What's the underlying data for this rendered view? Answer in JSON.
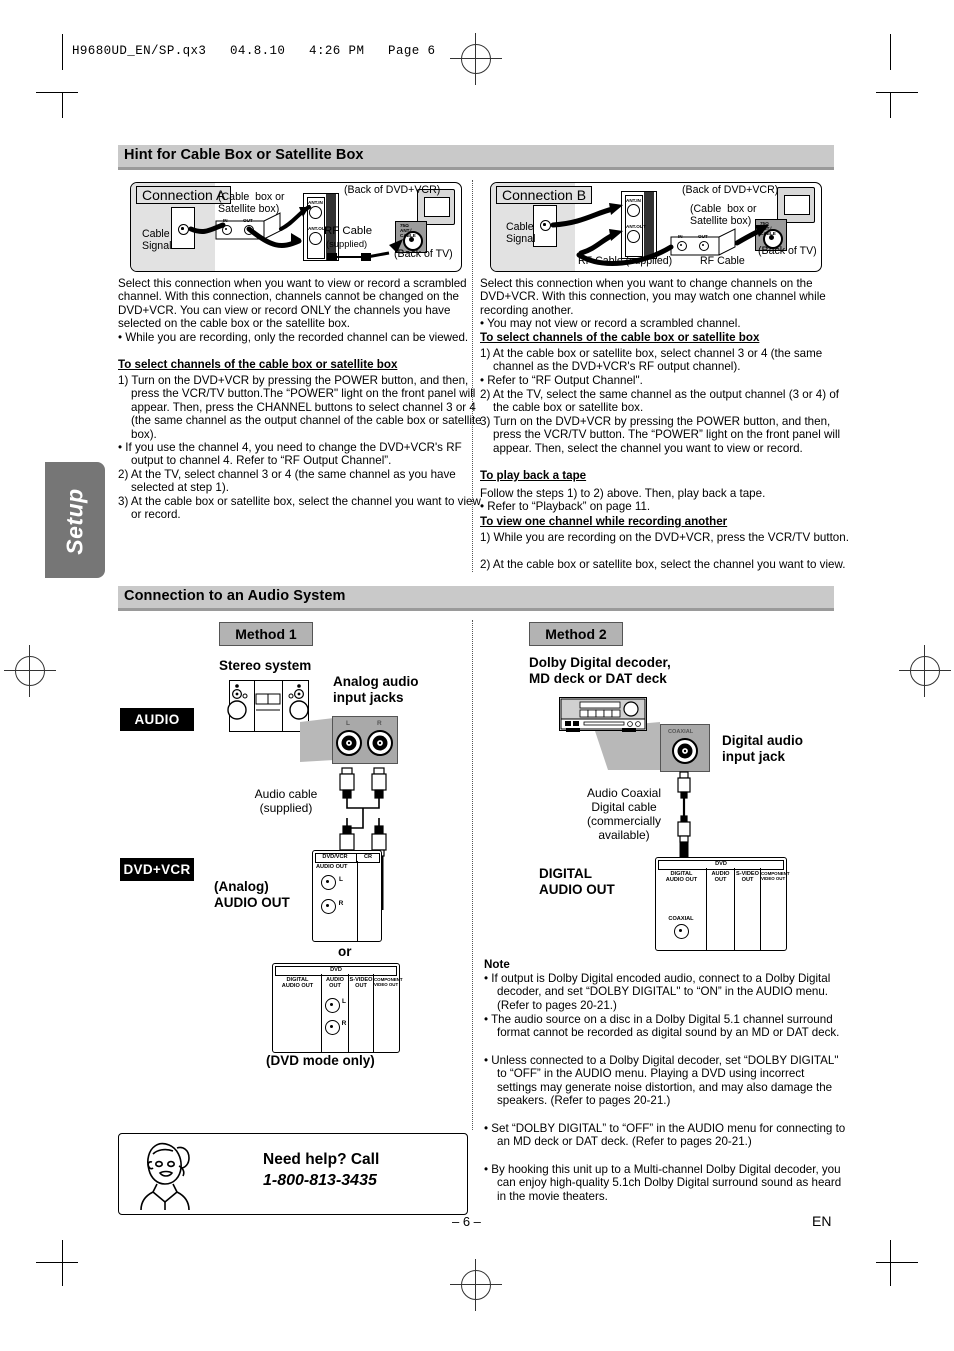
{
  "print_header": "H9680UD_EN/SP.qx3   04.8.10   4:26 PM   Page 6",
  "side_tab": "Setup",
  "section1": {
    "title": "Hint for Cable Box or Satellite Box",
    "connection_a": {
      "label": "Connection A",
      "captions": {
        "cable_signal": "Cable\nSignal",
        "cable_box": "(Cable  box or\nSatellite box)",
        "back_of_dvdvcr": "(Back of DVD+VCR)",
        "rf_cable": "RF Cable",
        "rf_supplied": "(supplied)",
        "back_of_tv": "(Back of TV)",
        "jack_in": "IN",
        "jack_out": "OUT",
        "ant_in": "ANT.IN",
        "ant_out": "ANT.OUT",
        "tv_jack": "75Ω\nANT./\nCABLE"
      },
      "body": "Select this connection when you want to view or record a scrambled channel. With this connection, channels cannot be changed on the DVD+VCR. You can view or record ONLY the channels you have selected on the cable box or the satellite box.",
      "bullet1": "• While you are recording, only the recorded channel can be viewed.",
      "subhead": "To select channels of the cable box or satellite box",
      "step1": "1) Turn on the DVD+VCR by pressing the POWER button, and then, press the VCR/TV button.The “POWER\" light on the front panel will appear. Then, press the CHANNEL buttons to select channel 3 or 4 (the same channel as the output channel of the cable box or satellite box).",
      "bullet2": "• If you use the channel 4, you need to change the DVD+VCR's RF output to channel 4. Refer to “RF Output Channel”.",
      "step2": "2) At the TV, select channel 3 or 4 (the same channel as you have selected at step 1).",
      "step3": "3) At the cable box or satellite box, select the channel you want to view or record."
    },
    "connection_b": {
      "label": "Connection B",
      "captions": {
        "cable_signal": "Cable\nSignal",
        "cable_box": "(Cable  box or\nSatellite box)",
        "back_of_dvdvcr": "(Back of DVD+VCR)",
        "rf_cable_supplied": "RF Cable (supplied)",
        "rf_cable": "RF Cable",
        "back_of_tv": "(Back of TV)",
        "jack_in": "IN",
        "jack_out": "OUT",
        "tv_jack": "75Ω\nANT./\nCABLE"
      },
      "body": "Select this connection when you want to change channels on the DVD+VCR. With this connection, you may watch one channel while recording another.",
      "bullet1": "• You may not view or record a scrambled channel.",
      "subhead1": "To select channels of the cable box or satellite box",
      "step1": "1) At the cable box or satellite box, select channel 3 or 4 (the same channel as the DVD+VCR's RF output channel).",
      "bullet2": "• Refer to “RF Output Channel\".",
      "step2": "2) At the TV, select the same channel as the output channel (3 or 4) of the cable box or satellite box.",
      "step3": "3) Turn on the DVD+VCR by pressing the POWER button, and then, press the VCR/TV button. The “POWER” light on the front panel will appear. Then, select the channel you want to view or record.",
      "subhead2": "To play back a tape",
      "play_body": "Follow the steps 1) to 2) above. Then, play back a tape.",
      "play_bullet": "• Refer to “Playback” on page 11.",
      "subhead3": "To view one channel while recording another",
      "view_step1": "1) While you are recording on the DVD+VCR, press the VCR/TV button.",
      "view_step2": "2) At the cable box or satellite box, select the channel you want to view."
    }
  },
  "section2": {
    "title": "Connection to an Audio System",
    "method1": {
      "badge": "Method 1",
      "device_label": "Stereo system",
      "jacks_label": "Analog audio\ninput jacks",
      "audio_tag": "AUDIO",
      "dvdvcr_tag": "DVD+VCR",
      "cable_label": "Audio cable\n(supplied)",
      "out_label": "(Analog)\nAUDIO OUT",
      "or_label": "or",
      "dvd_mode_label": "(DVD mode only)",
      "jack_l": "L",
      "jack_r": "R",
      "panel_vcr": {
        "header_left": "DVD/VCR",
        "header_right": "CR",
        "audio_out": "AUDIO OUT",
        "l": "L",
        "r": "R"
      },
      "panel_dvd": {
        "header": "DVD",
        "cells": [
          "DIGITAL\nAUDIO OUT",
          "AUDIO\nOUT",
          "S-VIDEO\nOUT",
          "COMPONENT\nVIDEO OUT"
        ],
        "l": "L",
        "r": "R"
      }
    },
    "method2": {
      "badge": "Method 2",
      "device_label": "Dolby Digital decoder,\nMD deck or DAT deck",
      "jack_label": "Digital audio\ninput jack",
      "coaxial_label": "COAXIAL",
      "cable_label": "Audio Coaxial\nDigital cable\n(commercially\navailable)",
      "out_label": "DIGITAL\nAUDIO OUT",
      "panel_dvd": {
        "header": "DVD",
        "cells": [
          "DIGITAL\nAUDIO OUT",
          "AUDIO\nOUT",
          "S-VIDEO\nOUT",
          "COMPONENT\nVIDEO OUT"
        ],
        "coaxial": "COAXIAL"
      }
    },
    "note": {
      "title": "Note",
      "items": [
        "• If output is Dolby Digital encoded audio, connect to a Dolby Digital decoder, and set “DOLBY DIGITAL\" to “ON” in the AUDIO menu. (Refer to pages 20-21.)",
        "• The audio source on a disc in a Dolby Digital 5.1 channel surround format cannot be recorded as digital sound by an MD or DAT deck.",
        "• Unless connected to a Dolby Digital decoder, set “DOLBY DIGITAL\" to “OFF” in the AUDIO menu. Playing a DVD using incorrect settings may generate noise distortion, and may also damage the speakers. (Refer to pages 20-21.)",
        "• Set “DOLBY DIGITAL” to “OFF” in the AUDIO menu for connecting to an MD deck or DAT deck. (Refer to pages 20-21.)",
        "• By hooking this unit up to a Multi-channel Dolby Digital decoder, you can enjoy high-quality 5.1ch Dolby Digital surround sound as heard in the movie theaters."
      ]
    }
  },
  "help": {
    "line1": "Need help? Call",
    "line2": "1-800-813-3435"
  },
  "footer": {
    "page": "– 6 –",
    "lang": "EN"
  }
}
